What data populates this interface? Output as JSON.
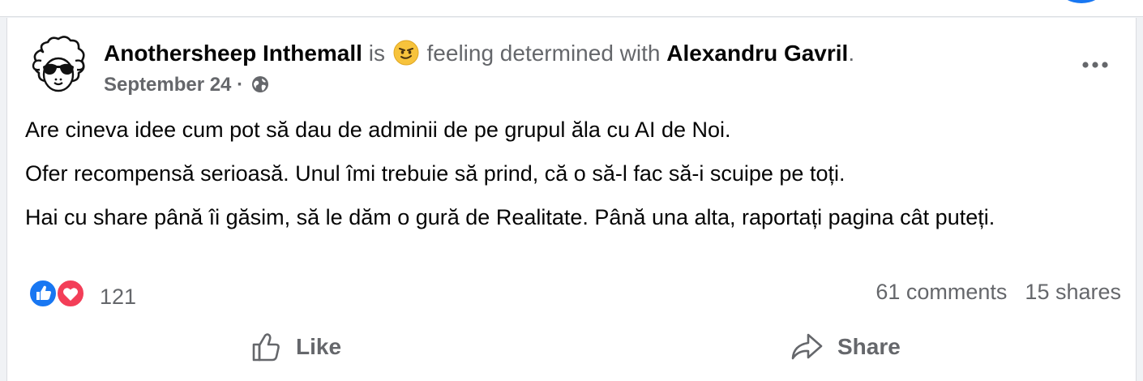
{
  "colors": {
    "brand": "#1877f2",
    "like_blue": "#1877f2",
    "love_red": "#f33e58",
    "text_primary": "#050505",
    "text_secondary": "#65676b",
    "emoji_yellow": "#f7c33c"
  },
  "post": {
    "author": "Anothersheep Inthemall",
    "is_word": "is",
    "feeling_text": "feeling determined with",
    "feeling_icon": "determined-smirk-emoji-icon",
    "tagged": "Alexandru Gavril",
    "trailing_period": ".",
    "date": "September 24",
    "separator": "·",
    "audience_icon": "globe-icon",
    "more_icon": "more-options-icon",
    "body": [
      "Are cineva idee cum pot să dau de adminii de pe grupul ăla cu AI de Noi.",
      "Ofer recompensă serioasă. Unul îmi  trebuie să prind, că o să-l fac să-i scuipe pe toți.",
      "Hai cu share până îi găsim, să le dăm o gură de Realitate. Până una alta, raportați pagina cât puteți."
    ]
  },
  "stats": {
    "reaction_icons": [
      "like-icon",
      "love-icon"
    ],
    "reaction_count": "121",
    "comments": "61 comments",
    "shares": "15 shares"
  },
  "actions": {
    "like_label": "Like",
    "share_label": "Share"
  }
}
